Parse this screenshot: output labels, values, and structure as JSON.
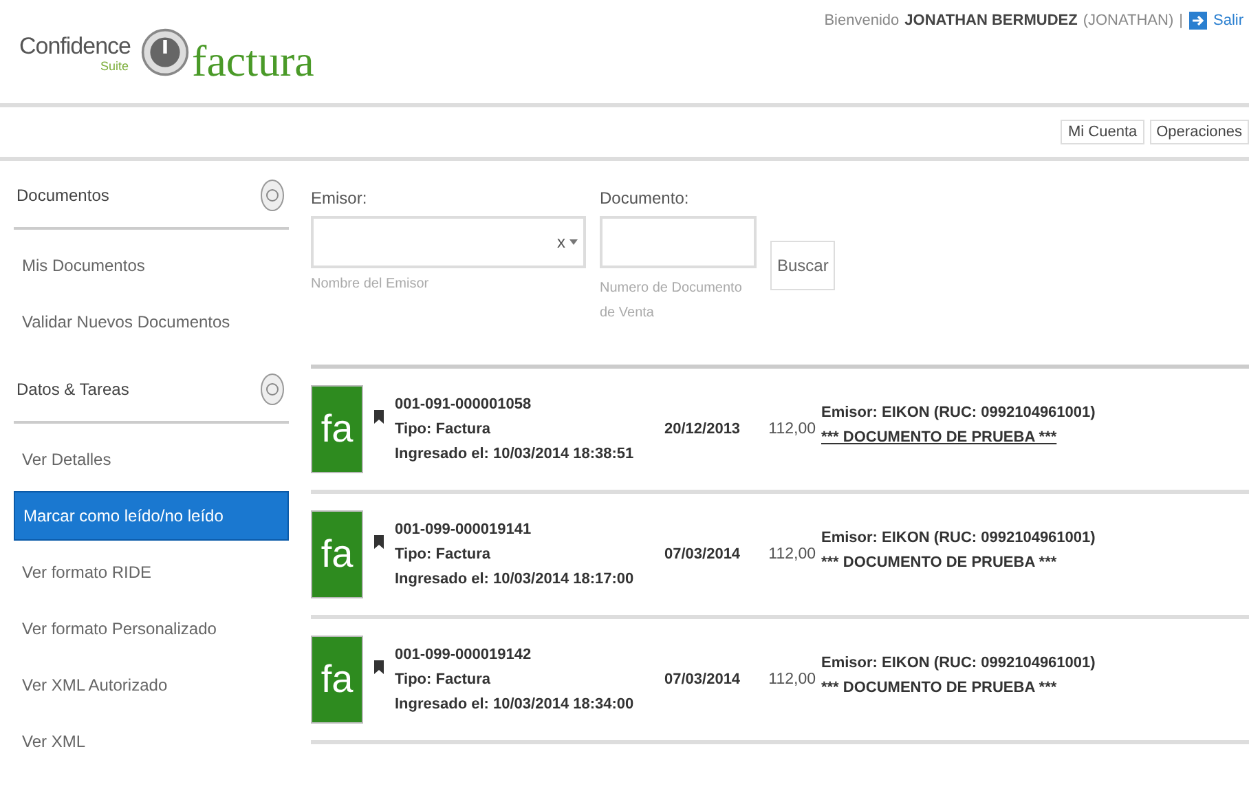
{
  "logo": {
    "brand": "Confidence",
    "suite": "Suite",
    "product": "factura"
  },
  "user_bar": {
    "greeting": "Bienvenido",
    "user_name": "JONATHAN BERMUDEZ",
    "user_login": "(JONATHAN)",
    "separator": "|",
    "logout": "Salir"
  },
  "top_nav": [
    {
      "label": "Mi Cuenta"
    },
    {
      "label": "Operaciones"
    }
  ],
  "sidebar": [
    {
      "title": "Documentos",
      "items": [
        {
          "label": "Mis Documentos",
          "selected": false
        },
        {
          "label": "Validar Nuevos Documentos",
          "selected": false
        }
      ]
    },
    {
      "title": "Datos & Tareas",
      "items": [
        {
          "label": "Ver Detalles",
          "selected": false
        },
        {
          "label": "Marcar como leído/no leído",
          "selected": true
        },
        {
          "label": "Ver formato RIDE",
          "selected": false
        },
        {
          "label": "Ver formato Personalizado",
          "selected": false
        },
        {
          "label": "Ver XML Autorizado",
          "selected": false
        },
        {
          "label": "Ver XML",
          "selected": false
        }
      ]
    }
  ],
  "filters": {
    "issuer": {
      "label": "Emisor:",
      "clear": "x",
      "hint": "Nombre del Emisor"
    },
    "document": {
      "label": "Documento:",
      "hint": "Numero de Documento de Venta"
    },
    "search_button": "Buscar"
  },
  "documents": [
    {
      "badge": "fa",
      "number": "001-091-000001058",
      "type": "Tipo: Factura",
      "received": "Ingresado el: 10/03/2014 18:38:51",
      "date": "20/12/2013",
      "amount": "112,00",
      "issuer": "Emisor: EIKON (RUC: 0992104961001)",
      "note": "*** DOCUMENTO DE PRUEBA ***",
      "underlined": true
    },
    {
      "badge": "fa",
      "number": "001-099-000019141",
      "type": "Tipo: Factura",
      "received": "Ingresado el: 10/03/2014 18:17:00",
      "date": "07/03/2014",
      "amount": "112,00",
      "issuer": "Emisor: EIKON (RUC: 0992104961001)",
      "note": "*** DOCUMENTO DE PRUEBA ***",
      "underlined": false
    },
    {
      "badge": "fa",
      "number": "001-099-000019142",
      "type": "Tipo: Factura",
      "received": "Ingresado el: 10/03/2014 18:34:00",
      "date": "07/03/2014",
      "amount": "112,00",
      "issuer": "Emisor: EIKON (RUC: 0992104961001)",
      "note": "*** DOCUMENTO DE PRUEBA ***",
      "underlined": false
    }
  ]
}
